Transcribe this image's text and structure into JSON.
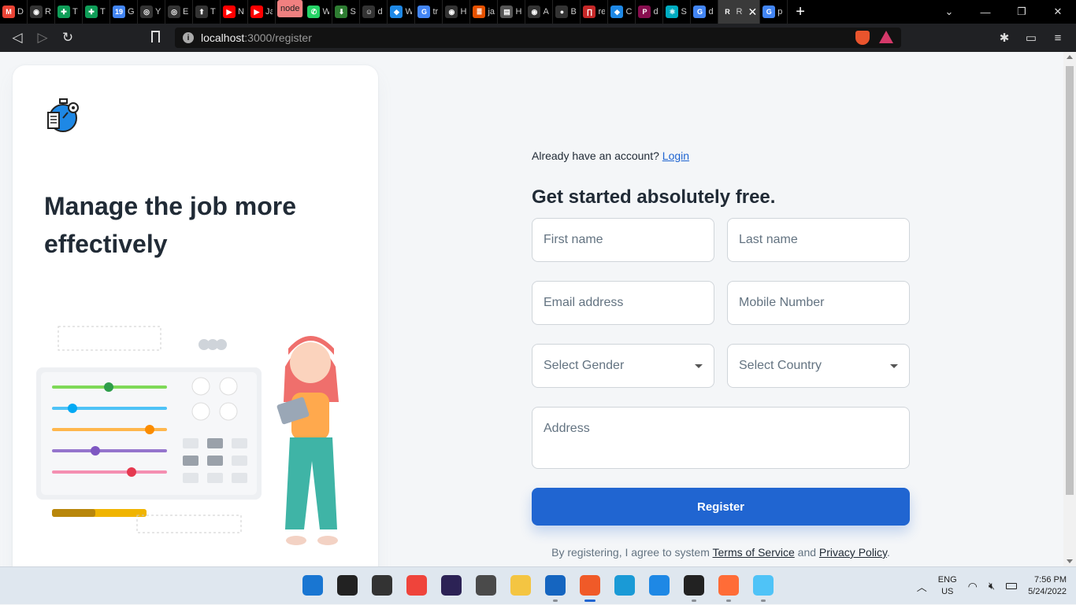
{
  "browser": {
    "tabs": [
      {
        "letter": "D",
        "color": "#ea4335",
        "glyph": "M"
      },
      {
        "letter": "R",
        "color": "#333",
        "glyph": "◉"
      },
      {
        "letter": "T",
        "color": "#0f9d58",
        "glyph": "✚"
      },
      {
        "letter": "T",
        "color": "#0f9d58",
        "glyph": "✚"
      },
      {
        "letter": "G",
        "color": "#4285f4",
        "glyph": "19"
      },
      {
        "letter": "Y",
        "color": "#333",
        "glyph": "◎"
      },
      {
        "letter": "E",
        "color": "#333",
        "glyph": "◎"
      },
      {
        "letter": "T",
        "color": "#333",
        "glyph": "⬆"
      },
      {
        "letter": "N",
        "color": "#ff0000",
        "glyph": "▶"
      },
      {
        "letter": "Ja",
        "color": "#ff0000",
        "glyph": "▶"
      },
      {
        "letter": "node",
        "color": "#f08080",
        "glyph": ""
      },
      {
        "letter": "W",
        "color": "#25d366",
        "glyph": "✆"
      },
      {
        "letter": "S",
        "color": "#2e7d32",
        "glyph": "⬇"
      },
      {
        "letter": "d",
        "color": "#333",
        "glyph": "☺"
      },
      {
        "letter": "W",
        "color": "#1e88e5",
        "glyph": "◆"
      },
      {
        "letter": "tr",
        "color": "#4285f4",
        "glyph": "G"
      },
      {
        "letter": "H",
        "color": "#333",
        "glyph": "◉"
      },
      {
        "letter": "ja",
        "color": "#e65100",
        "glyph": "≣"
      },
      {
        "letter": "H",
        "color": "#555",
        "glyph": "▤"
      },
      {
        "letter": "A",
        "color": "#333",
        "glyph": "◉"
      },
      {
        "letter": "B",
        "color": "#333",
        "glyph": "●"
      },
      {
        "letter": "re",
        "color": "#c62828",
        "glyph": "∏"
      },
      {
        "letter": "C",
        "color": "#1e88e5",
        "glyph": "◆"
      },
      {
        "letter": "d",
        "color": "#880e4f",
        "glyph": "P"
      },
      {
        "letter": "S",
        "color": "#00acc1",
        "glyph": "⚛"
      },
      {
        "letter": "d",
        "color": "#4285f4",
        "glyph": "G"
      },
      {
        "letter": "Re",
        "color": "#fff",
        "glyph": "R"
      },
      {
        "letter": "p",
        "color": "#4285f4",
        "glyph": "G"
      }
    ],
    "url_host": "localhost",
    "url_path": ":3000/register",
    "new_tab": "+",
    "window_controls": [
      "⌄",
      "—",
      "❐",
      "✕"
    ]
  },
  "page": {
    "hero_title": "Manage the job more effectively",
    "login_prompt": "Already have an account?",
    "login_link": "Login",
    "form_title": "Get started absolutely free.",
    "fields": {
      "first_name": "First name",
      "last_name": "Last name",
      "email": "Email address",
      "mobile": "Mobile Number",
      "gender": "Select Gender",
      "country": "Select Country",
      "address": "Address"
    },
    "register_label": "Register",
    "terms_prefix": "By registering, I agree to system",
    "terms_link": "Terms of Service",
    "terms_and": "and",
    "privacy_link": "Privacy Policy",
    "terms_suffix": "."
  },
  "taskbar": {
    "lang_line1": "ENG",
    "lang_line2": "US",
    "time": "7:56 PM",
    "date": "5/24/2022",
    "apps": [
      {
        "name": "start",
        "color": "#1976d2"
      },
      {
        "name": "search",
        "color": "#222"
      },
      {
        "name": "task-view",
        "color": "#333"
      },
      {
        "name": "anydesk",
        "color": "#ef443b"
      },
      {
        "name": "eclipse",
        "color": "#2c2255"
      },
      {
        "name": "sublime",
        "color": "#4a4a4a"
      },
      {
        "name": "file-explorer",
        "color": "#f4c542"
      },
      {
        "name": "store",
        "color": "#1565c0"
      },
      {
        "name": "brave",
        "color": "#f05a28"
      },
      {
        "name": "edge",
        "color": "#1a9ad6"
      },
      {
        "name": "mail",
        "color": "#1e88e5"
      },
      {
        "name": "terminal",
        "color": "#222"
      },
      {
        "name": "postman",
        "color": "#ff6c37"
      },
      {
        "name": "notepad",
        "color": "#4fc3f7"
      }
    ]
  }
}
